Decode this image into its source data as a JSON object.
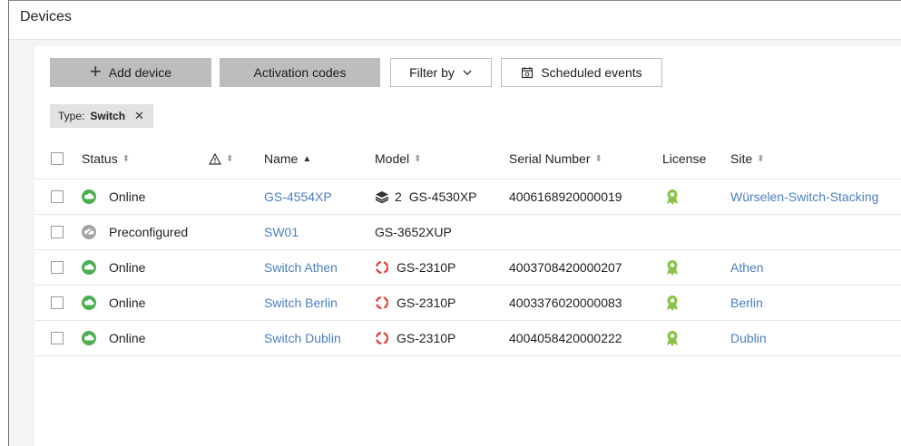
{
  "header": {
    "title": "Devices"
  },
  "toolbar": {
    "add_label": "Add device",
    "activation_label": "Activation codes",
    "filter_label": "Filter by",
    "scheduled_label": "Scheduled events"
  },
  "filter_chip": {
    "key": "Type:",
    "value": "Switch"
  },
  "columns": {
    "status": "Status",
    "name": "Name",
    "model": "Model",
    "serial": "Serial Number",
    "license": "License",
    "site": "Site"
  },
  "rows": [
    {
      "status": "Online",
      "status_color": "#4caf50",
      "name": "GS-4554XP",
      "stack_count": "2",
      "model_icon": "stack-icon",
      "model": "GS-4530XP",
      "serial": "4006168920000019",
      "license": "license-badge-icon",
      "site": "Würselen-Switch-Stacking"
    },
    {
      "status": "Preconfigured",
      "status_color": "#a3a3a3",
      "name": "SW01",
      "model_icon": "",
      "model": "GS-3652XUP",
      "serial": "",
      "license": "",
      "site": ""
    },
    {
      "status": "Online",
      "status_color": "#4caf50",
      "name": "Switch Athen",
      "model_icon": "alert-ring-icon",
      "model": "GS-2310P",
      "serial": "4003708420000207",
      "license": "license-badge-icon",
      "site": "Athen"
    },
    {
      "status": "Online",
      "status_color": "#4caf50",
      "name": "Switch Berlin",
      "model_icon": "alert-ring-icon",
      "model": "GS-2310P",
      "serial": "4003376020000083",
      "license": "license-badge-icon",
      "site": "Berlin"
    },
    {
      "status": "Online",
      "status_color": "#4caf50",
      "name": "Switch Dublin",
      "model_icon": "alert-ring-icon",
      "model": "GS-2310P",
      "serial": "4004058420000222",
      "license": "license-badge-icon",
      "site": "Dublin"
    }
  ],
  "colors": {
    "link": "#4a7fc1",
    "online": "#4caf50",
    "preconfigured": "#a3a3a3",
    "alert": "#e53935",
    "license": "#8bc34a"
  }
}
